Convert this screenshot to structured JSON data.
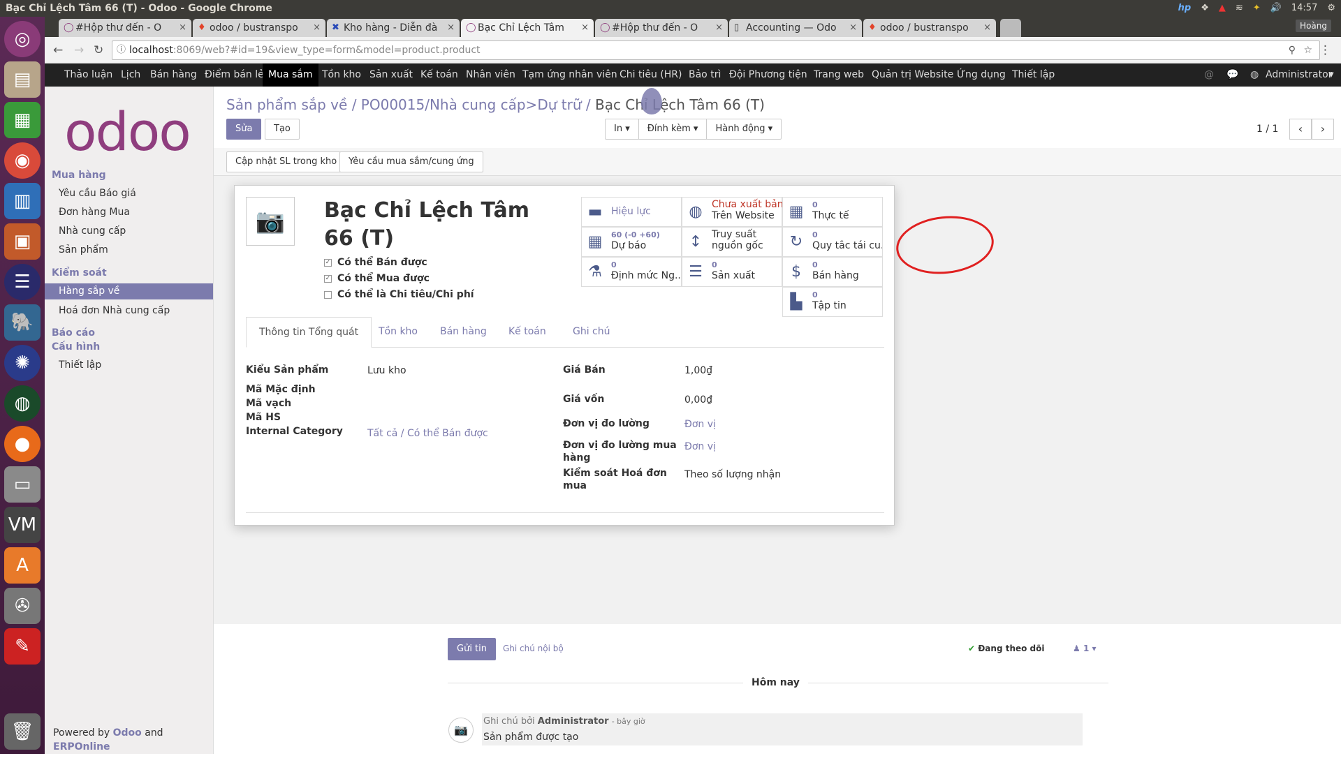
{
  "window_title": "Bạc Chỉ Lệch Tâm 66 (T) - Odoo - Google Chrome",
  "system_tray": {
    "clock": "14:57",
    "user": "Hoàng"
  },
  "tabs": [
    {
      "label": "#Hộp thư đến - O",
      "icon": "odoo-icon"
    },
    {
      "label": "odoo / bustranspo",
      "icon": "gitlab-icon"
    },
    {
      "label": "Kho hàng - Diễn đà",
      "icon": "forum-icon"
    },
    {
      "label": "Bạc Chỉ Lệch Tâm",
      "icon": "odoo-icon",
      "active": true
    },
    {
      "label": "#Hộp thư đến - O",
      "icon": "odoo-icon"
    },
    {
      "label": "Accounting — Odo",
      "icon": "page-icon"
    },
    {
      "label": "odoo / bustranspo",
      "icon": "gitlab-icon"
    }
  ],
  "url": {
    "host": "localhost",
    "path": ":8069/web?#id=19&view_type=form&model=product.product"
  },
  "topnav": [
    "Thảo luận",
    "Lịch",
    "Bán hàng",
    "Điểm bán lẻ",
    "Mua sắm",
    "Tồn kho",
    "Sản xuất",
    "Kế toán",
    "Nhân viên",
    "Tạm ứng nhân viên",
    "Chi tiêu (HR)",
    "Bảo trì",
    "Đội Phương tiện",
    "Trang web",
    "Quản trị Website",
    "Ứng dụng",
    "Thiết lập"
  ],
  "topnav_active": "Mua sắm",
  "user_menu": "Administrator",
  "sidebar": {
    "logo": "odoo",
    "sections": [
      {
        "heading": "Mua hàng",
        "items": [
          "Yêu cầu Báo giá",
          "Đơn hàng Mua",
          "Nhà cung cấp",
          "Sản phẩm"
        ]
      },
      {
        "heading": "Kiểm soát",
        "items": [
          "Hàng sắp về",
          "Hoá đơn Nhà cung cấp"
        ]
      },
      {
        "heading": "Báo cáo",
        "items": []
      },
      {
        "heading": "Cấu hình",
        "items": [
          "Thiết lập"
        ]
      }
    ],
    "selected": "Hàng sắp về",
    "powered_prefix": "Powered by",
    "powered_odoo": "Odoo",
    "powered_and": "and",
    "powered_erp": "ERPOnline"
  },
  "breadcrumb": {
    "b1": "Sản phẩm sắp về",
    "b2": "PO00015/Nhà cung cấp>Dự trữ",
    "current": "Bạc Chỉ Lệch Tâm 66 (T)",
    "sep": "/"
  },
  "buttons": {
    "edit": "Sửa",
    "create": "Tạo",
    "print": "In",
    "attach": "Đính kèm",
    "action": "Hành động",
    "update_qty": "Cập nhật SL trong kho",
    "procurement": "Yêu cầu mua sắm/cung ứng"
  },
  "pager": "1 / 1",
  "product": {
    "name": "Bạc Chỉ Lệch Tâm 66 (T)",
    "can_sell": "Có thể Bán được",
    "can_buy": "Có thể Mua được",
    "can_expense": "Có thể là Chi tiêu/Chi phí"
  },
  "stat_buttons": {
    "active": "Hiệu lực",
    "published_1": "Chưa xuất bản",
    "published_2": "Trên Website",
    "real_n": "0",
    "real": "Thực tế",
    "forecast_n": "60 (-0 +60)",
    "forecast": "Dự báo",
    "trace_1": "Truy suất",
    "trace_2": "nguồn gốc",
    "reorder_n": "0",
    "reorder": "Quy tắc tái cu...",
    "bom_n": "0",
    "bom": "Định mức Ng...",
    "mfg_n": "0",
    "mfg": "Sản xuất",
    "sales_n": "0",
    "sales": "Bán hàng",
    "docs_n": "0",
    "docs": "Tập tin"
  },
  "form_tabs": [
    "Thông tin Tổng quát",
    "Tồn kho",
    "Bán hàng",
    "Kế toán",
    "Ghi chú"
  ],
  "fields": {
    "type_label": "Kiểu Sản phẩm",
    "type_value": "Lưu kho",
    "ref_label": "Mã Mặc định",
    "barcode_label": "Mã vạch",
    "hs_label": "Mã HS",
    "categ_label": "Internal Category",
    "categ_value": "Tất cả / Có thể Bán được",
    "price_label": "Giá Bán",
    "price_value": "1,00₫",
    "cost_label": "Giá vốn",
    "cost_value": "0,00₫",
    "uom_label": "Đơn vị đo lường",
    "uom_value": "Đơn vị",
    "uom_po_label_1": "Đơn vị đo lường mua",
    "uom_po_label_2": "hàng",
    "uom_po_value": "Đơn vị",
    "invoice_label_1": "Kiểm soát Hoá đơn",
    "invoice_label_2": "mua",
    "invoice_value": "Theo số lượng nhận"
  },
  "chatter": {
    "send": "Gửi tin",
    "note": "Ghi chú nội bộ",
    "following": "Đang theo dõi",
    "followers": "1",
    "today": "Hôm nay",
    "msg_prefix": "Ghi chú bởi",
    "msg_author": "Administrator",
    "msg_time": "- bây giờ",
    "msg_body": "Sản phẩm được tạo"
  },
  "colors": {
    "accent": "#7c7bad",
    "nav": "#222222",
    "launcher": "#4a2145",
    "annotation": "#e02020"
  }
}
